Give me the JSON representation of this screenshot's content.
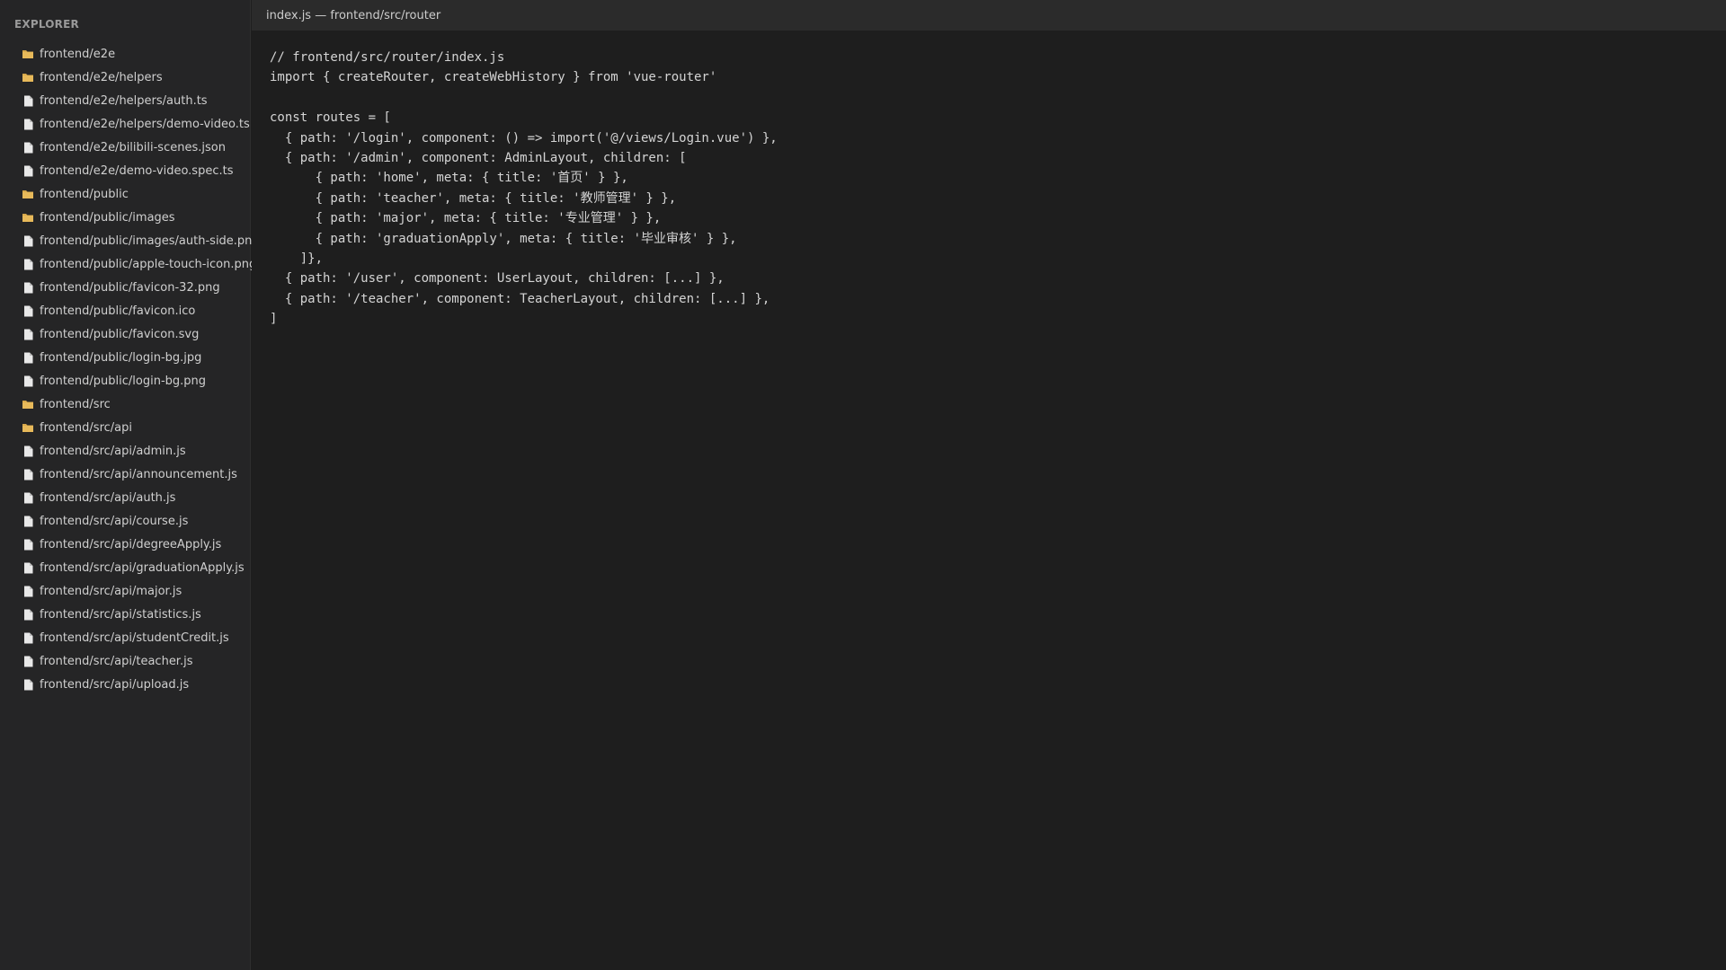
{
  "sidebar": {
    "title": "EXPLORER",
    "items": [
      {
        "type": "folder",
        "label": "frontend/e2e"
      },
      {
        "type": "folder",
        "label": "frontend/e2e/helpers"
      },
      {
        "type": "file",
        "label": "frontend/e2e/helpers/auth.ts"
      },
      {
        "type": "file",
        "label": "frontend/e2e/helpers/demo-video.ts"
      },
      {
        "type": "file",
        "label": "frontend/e2e/bilibili-scenes.json"
      },
      {
        "type": "file",
        "label": "frontend/e2e/demo-video.spec.ts"
      },
      {
        "type": "folder",
        "label": "frontend/public"
      },
      {
        "type": "folder",
        "label": "frontend/public/images"
      },
      {
        "type": "file",
        "label": "frontend/public/images/auth-side.png"
      },
      {
        "type": "file",
        "label": "frontend/public/apple-touch-icon.png"
      },
      {
        "type": "file",
        "label": "frontend/public/favicon-32.png"
      },
      {
        "type": "file",
        "label": "frontend/public/favicon.ico"
      },
      {
        "type": "file",
        "label": "frontend/public/favicon.svg"
      },
      {
        "type": "file",
        "label": "frontend/public/login-bg.jpg"
      },
      {
        "type": "file",
        "label": "frontend/public/login-bg.png"
      },
      {
        "type": "folder",
        "label": "frontend/src"
      },
      {
        "type": "folder",
        "label": "frontend/src/api"
      },
      {
        "type": "file",
        "label": "frontend/src/api/admin.js"
      },
      {
        "type": "file",
        "label": "frontend/src/api/announcement.js"
      },
      {
        "type": "file",
        "label": "frontend/src/api/auth.js"
      },
      {
        "type": "file",
        "label": "frontend/src/api/course.js"
      },
      {
        "type": "file",
        "label": "frontend/src/api/degreeApply.js"
      },
      {
        "type": "file",
        "label": "frontend/src/api/graduationApply.js"
      },
      {
        "type": "file",
        "label": "frontend/src/api/major.js"
      },
      {
        "type": "file",
        "label": "frontend/src/api/statistics.js"
      },
      {
        "type": "file",
        "label": "frontend/src/api/studentCredit.js"
      },
      {
        "type": "file",
        "label": "frontend/src/api/teacher.js"
      },
      {
        "type": "file",
        "label": "frontend/src/api/upload.js"
      }
    ]
  },
  "editor": {
    "title": "index.js — frontend/src/router",
    "lines": [
      "// frontend/src/router/index.js",
      "import { createRouter, createWebHistory } from 'vue-router'",
      "",
      "const routes = [",
      "  { path: '/login', component: () => import('@/views/Login.vue') },",
      "  { path: '/admin', component: AdminLayout, children: [",
      "      { path: 'home', meta: { title: '首页' } },",
      "      { path: 'teacher', meta: { title: '教师管理' } },",
      "      { path: 'major', meta: { title: '专业管理' } },",
      "      { path: 'graduationApply', meta: { title: '毕业审核' } },",
      "    ]},",
      "  { path: '/user', component: UserLayout, children: [...] },",
      "  { path: '/teacher', component: TeacherLayout, children: [...] },",
      "]"
    ]
  },
  "colors": {
    "sidebar_bg": "#252526",
    "editor_bg": "#1e1e1e",
    "titlebar_bg": "#2b2b2b",
    "folder_icon": "#d8a84a",
    "file_icon": "#cfcfcf"
  }
}
